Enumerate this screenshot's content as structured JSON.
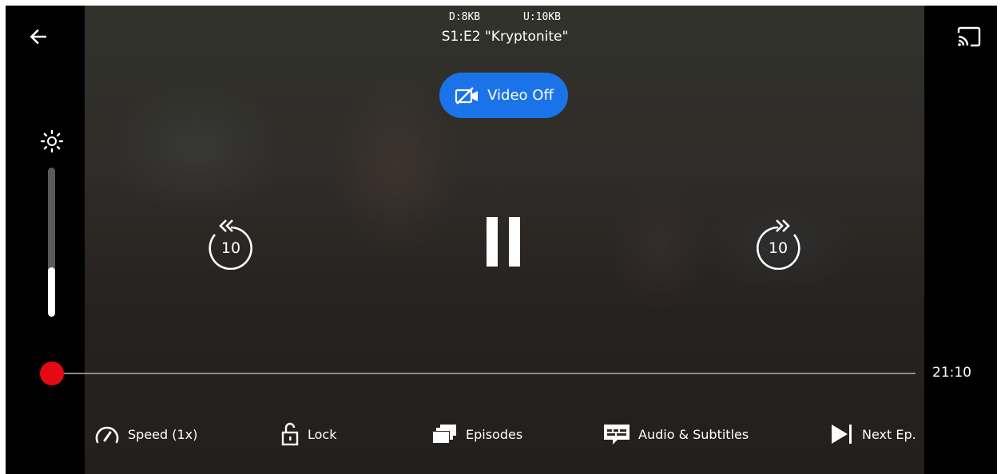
{
  "header": {
    "download_stat": "D:8KB",
    "upload_stat": "U:10KB",
    "episode_title": "S1:E2 \"Kryptonite\""
  },
  "video_off": {
    "label": "Video Off"
  },
  "brightness": {
    "level": 0.33
  },
  "skip": {
    "rewind_seconds": "10",
    "forward_seconds": "10"
  },
  "progress": {
    "elapsed_fraction": 0.0,
    "time_remaining": "21:10"
  },
  "bottom_bar": {
    "speed_label": "Speed (1x)",
    "lock_label": "Lock",
    "episodes_label": "Episodes",
    "audio_subtitles_label": "Audio & Subtitles",
    "next_episode_label": "Next Ep."
  },
  "colors": {
    "accent_red": "#e50914",
    "video_off_blue": "#1a73e8"
  }
}
